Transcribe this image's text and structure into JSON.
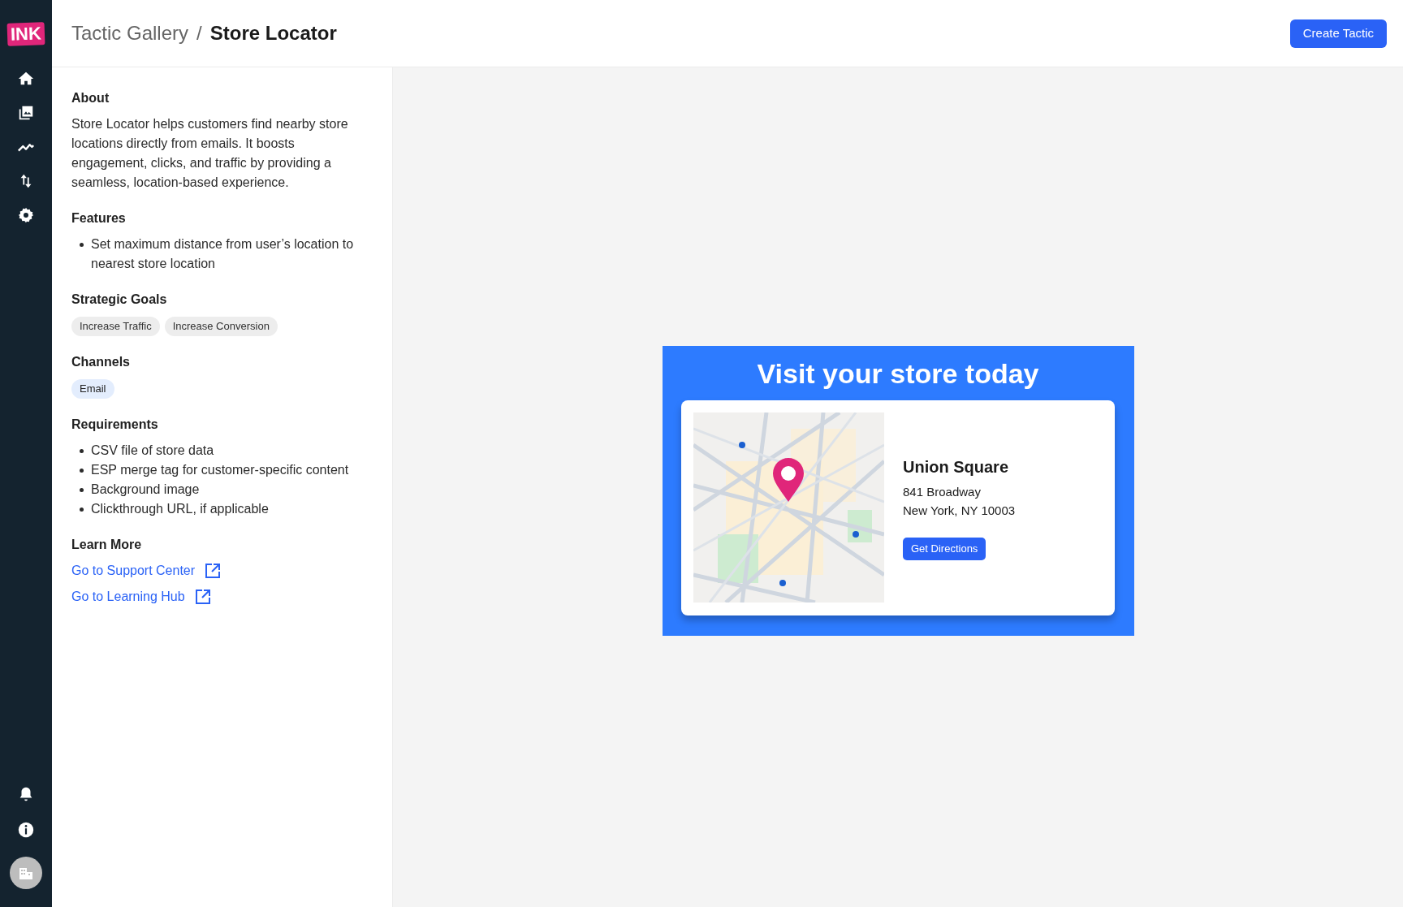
{
  "logo": "INK",
  "nav": [
    {
      "kind": "home"
    },
    {
      "kind": "gallery"
    },
    {
      "kind": "chart"
    },
    {
      "kind": "sort"
    },
    {
      "kind": "settings"
    }
  ],
  "nav_bottom": [
    {
      "kind": "bell"
    },
    {
      "kind": "info"
    },
    {
      "kind": "avatar"
    }
  ],
  "breadcrumb": {
    "parent": "Tactic Gallery",
    "separator": "/",
    "current": "Store Locator"
  },
  "primary_button": "Create Tactic",
  "about": {
    "heading": "About",
    "text": "Store Locator helps customers find nearby store locations directly from emails. It boosts engagement, clicks, and traffic by providing a seamless, location-based experience."
  },
  "features": {
    "heading": "Features",
    "items": [
      "Set maximum distance from user’s location to nearest store location"
    ]
  },
  "strategic_goals": {
    "heading": "Strategic Goals",
    "tags": [
      "Increase Traffic",
      "Increase Conversion"
    ]
  },
  "channels": {
    "heading": "Channels",
    "tags": [
      "Email"
    ]
  },
  "requirements": {
    "heading": "Requirements",
    "items": [
      "CSV file of store data",
      "ESP merge tag for customer-specific content",
      "Background image",
      "Clickthrough URL, if applicable"
    ]
  },
  "learn_more": {
    "heading": "Learn More",
    "links": [
      "Go to Support Center",
      "Go to Learning Hub"
    ]
  },
  "preview": {
    "headline": "Visit your store today",
    "map": {
      "kind": "picture"
    },
    "store_name": "Union Square",
    "address_lines": [
      "841 Broadway",
      "New York, NY 10003"
    ],
    "button": "Get Directions"
  }
}
